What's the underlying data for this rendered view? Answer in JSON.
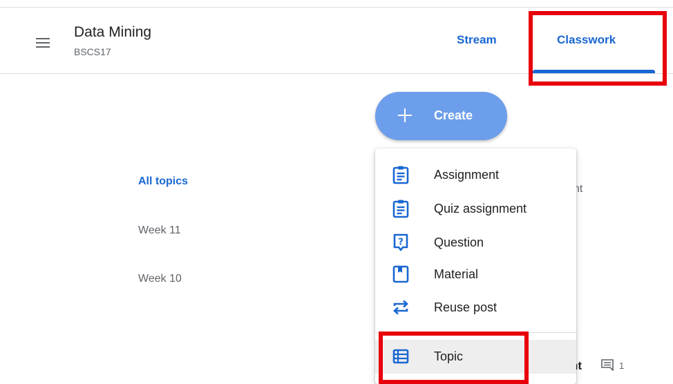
{
  "header": {
    "class_title": "Data Mining",
    "class_section": "BSCS17",
    "tabs": [
      {
        "label": "Stream"
      },
      {
        "label": "Classwork",
        "active": true
      }
    ]
  },
  "create_button": {
    "label": "Create"
  },
  "create_menu": {
    "items": [
      {
        "label": "Assignment",
        "icon": "assignment-icon"
      },
      {
        "label": "Quiz assignment",
        "icon": "quiz-assignment-icon"
      },
      {
        "label": "Question",
        "icon": "question-icon"
      },
      {
        "label": "Material",
        "icon": "material-icon"
      },
      {
        "label": "Reuse post",
        "icon": "reuse-icon"
      },
      {
        "label": "Topic",
        "icon": "topic-icon",
        "hovered": true
      }
    ]
  },
  "topics_nav": {
    "items": [
      {
        "label": "All topics",
        "active": true
      },
      {
        "label": "Week 11"
      },
      {
        "label": "Week 10"
      }
    ]
  },
  "background_content": {
    "partial_text_1": "nt",
    "partial_text_2": "nt",
    "comment_count": "1"
  },
  "colors": {
    "accent": "#1967d2",
    "create_button": "#6d9eeb",
    "highlight_box": "#e8000b",
    "menu_hover": "#eeeeee"
  }
}
